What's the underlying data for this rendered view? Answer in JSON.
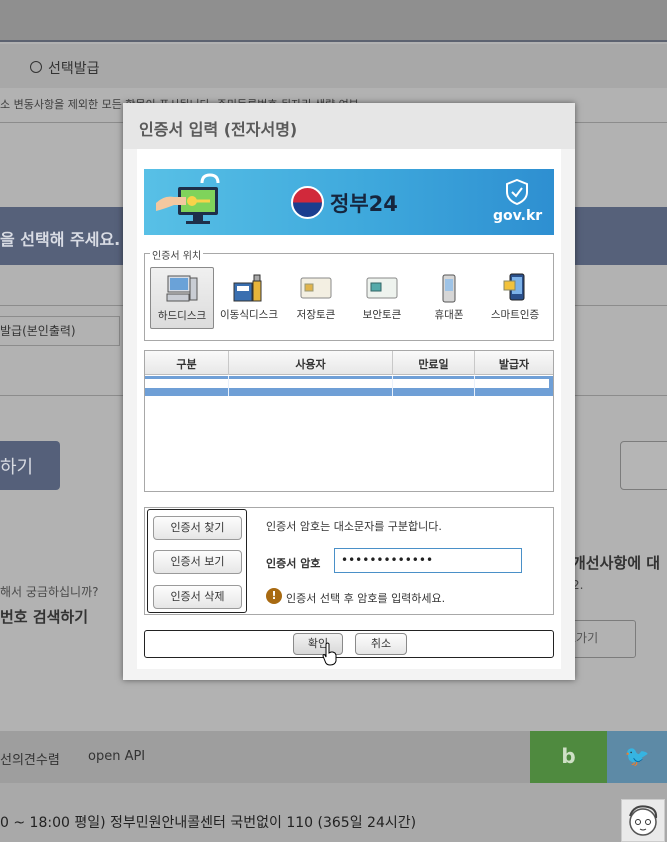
{
  "background": {
    "radio_label": "선택발급",
    "note": "소 변동사항을 제외한 모든 항목이 표시됩니다. 주민등록번호 뒷자리 생략 여부",
    "bar_text": "을 선택해 주세요.",
    "select_value": "발급(본인출력)",
    "left_button": "하기",
    "question": "해서 궁금하십니까?",
    "search_link": "번호 검색하기",
    "right_heading": "개선사항에 대",
    "right_sub": "2.",
    "right_button": "로가기",
    "footer_item_1": "선의견수렴",
    "footer_item_2": "open API",
    "blog_label": "b",
    "twitter_label": "🐦",
    "call_center": "0 ~ 18:00 평일) 정부민원안내콜센터 국번없이 110 (365일 24시간)"
  },
  "modal": {
    "title": "인증서 입력 (전자서명)",
    "banner": {
      "logo_text": "정부24",
      "domain": "gov.kr"
    },
    "location": {
      "group_title": "인증서 위치",
      "items": [
        {
          "label": "하드디스크",
          "icon": "hard-disk-icon",
          "selected": true
        },
        {
          "label": "이동식디스크",
          "icon": "removable-disk-icon",
          "selected": false
        },
        {
          "label": "저장토큰",
          "icon": "storage-token-icon",
          "selected": false
        },
        {
          "label": "보안토큰",
          "icon": "security-token-icon",
          "selected": false
        },
        {
          "label": "휴대폰",
          "icon": "mobile-phone-icon",
          "selected": false
        },
        {
          "label": "스마트인증",
          "icon": "smart-auth-icon",
          "selected": false
        }
      ]
    },
    "table": {
      "headers": [
        "구분",
        "사용자",
        "만료일",
        "발급자"
      ]
    },
    "buttons": {
      "find": "인증서 찾기",
      "view": "인증서 보기",
      "delete": "인증서 삭제",
      "ok": "확인",
      "cancel": "취소"
    },
    "password": {
      "info": "인증서 암호는 대소문자를 구분합니다.",
      "label": "인증서 암호",
      "masked_value": "•••••••••••••",
      "warning_icon": "!",
      "warning": "인증서 선택 후 암호를 입력하세요."
    }
  },
  "colors": {
    "selected_row": "#6f9fd6",
    "banner": "#3ea8dc",
    "input_border": "#4a90c8"
  }
}
